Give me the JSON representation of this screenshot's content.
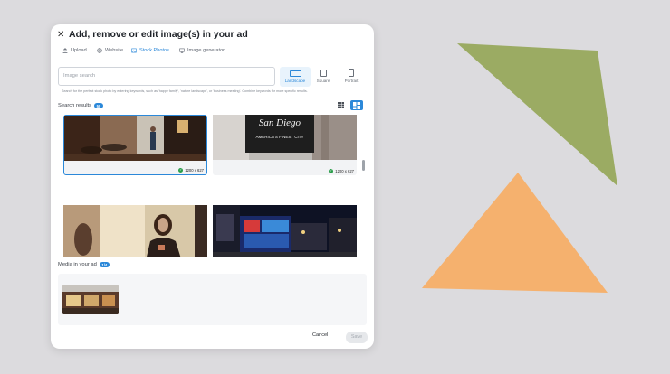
{
  "colors": {
    "page_bg": "#dcdbde",
    "accent": "#2b88d9",
    "green_triangle": "#9bab63",
    "orange_triangle": "#f5b16e",
    "check_green": "#2a9d4a"
  },
  "modal": {
    "close_icon": "close-icon",
    "title": "Add, remove or edit image(s) in your ad"
  },
  "tabs": [
    {
      "label": "Upload",
      "icon": "upload-icon"
    },
    {
      "label": "Website",
      "icon": "globe-icon"
    },
    {
      "label": "Stock Photos",
      "icon": "image-icon",
      "active": true
    },
    {
      "label": "Image generator",
      "icon": "monitor-icon"
    }
  ],
  "search": {
    "placeholder": "Image search",
    "hint": "Search for the perfect stock photo by entering keywords, such as 'happy family', 'nature landscape', or 'business meeting'. Combine keywords for more specific results."
  },
  "orientation": [
    {
      "label": "Landscape",
      "active": true
    },
    {
      "label": "Square"
    },
    {
      "label": "Portrait"
    }
  ],
  "results": {
    "label": "Search results",
    "count": "50",
    "items": [
      {
        "dims": "1200 x 627",
        "selected": true,
        "description": "restaurant interior"
      },
      {
        "dims": "1200 x 627",
        "selected": false,
        "description": "San Diego sign"
      },
      {
        "description": "woman with phone"
      },
      {
        "description": "city lights at night"
      }
    ]
  },
  "media": {
    "label": "Media in your ad",
    "count": "1/4"
  },
  "footer": {
    "cancel": "Cancel",
    "save": "Save"
  },
  "sign_text": {
    "line1": "San Diego",
    "line2": "AMERICA'S FINEST CITY"
  }
}
